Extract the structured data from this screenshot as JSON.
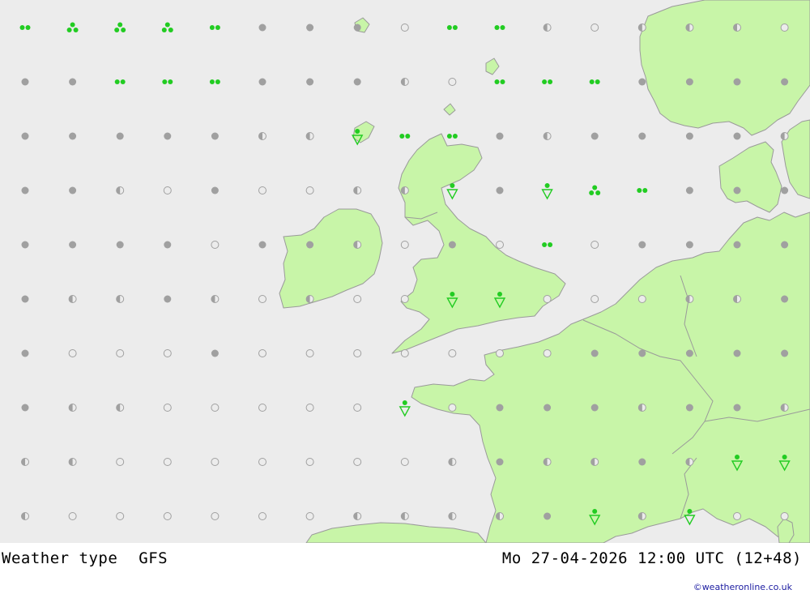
{
  "map": {
    "colors": {
      "sea": "#ececec",
      "land": "#c8f5a8",
      "border": "#9a9a9a",
      "sym_grey": "#a0a0a0",
      "sym_green": "#22cc22"
    },
    "legend_title": "Weather type",
    "model": "GFS",
    "valid_time": "Mo 27-04-2026 12:00 UTC (12+48)",
    "credit": "©weatheronline.co.uk",
    "rows": [
      [
        "g2",
        "g3",
        "g3",
        "g3",
        "g2",
        "pf",
        "pf",
        "pf",
        "po",
        "g2",
        "g2",
        "ph",
        "po",
        "ph",
        "ph",
        "ph",
        "po"
      ],
      [
        "pf",
        "pf",
        "g2",
        "g2",
        "g2",
        "pf",
        "pf",
        "pf",
        "ph",
        "po",
        "g2",
        "g2",
        "g2",
        "pf",
        "pf",
        "pf",
        "pf"
      ],
      [
        "pf",
        "pf",
        "pf",
        "pf",
        "pf",
        "ph",
        "ph",
        "gs",
        "g2",
        "g2",
        "pf",
        "ph",
        "pf",
        "pf",
        "pf",
        "pf",
        "ph"
      ],
      [
        "pf",
        "pf",
        "ph",
        "po",
        "pf",
        "po",
        "po",
        "ph",
        "ph",
        "gs",
        "pf",
        "gs",
        "g3",
        "g2",
        "pf",
        "pf",
        "pf"
      ],
      [
        "pf",
        "pf",
        "pf",
        "pf",
        "po",
        "pf",
        "pf",
        "ph",
        "po",
        "pf",
        "po",
        "g2",
        "po",
        "pf",
        "pf",
        "pf",
        "pf"
      ],
      [
        "pf",
        "ph",
        "ph",
        "pf",
        "ph",
        "po",
        "ph",
        "po",
        "po",
        "gs",
        "gs",
        "po",
        "po",
        "po",
        "ph",
        "ph",
        "pf"
      ],
      [
        "pf",
        "po",
        "po",
        "po",
        "pf",
        "po",
        "po",
        "po",
        "po",
        "po",
        "po",
        "po",
        "pf",
        "pf",
        "pf",
        "pf",
        "pf"
      ],
      [
        "pf",
        "ph",
        "ph",
        "po",
        "po",
        "po",
        "po",
        "po",
        "gs",
        "po",
        "pf",
        "pf",
        "pf",
        "ph",
        "pf",
        "pf",
        "ph"
      ],
      [
        "ph",
        "ph",
        "po",
        "po",
        "po",
        "po",
        "po",
        "po",
        "po",
        "ph",
        "pf",
        "ph",
        "ph",
        "pf",
        "ph",
        "gs",
        "gs"
      ],
      [
        "ph",
        "po",
        "po",
        "po",
        "po",
        "po",
        "po",
        "ph",
        "ph",
        "ph",
        "ph",
        "pf",
        "gs",
        "ph",
        "gs",
        "po",
        "po"
      ]
    ]
  }
}
